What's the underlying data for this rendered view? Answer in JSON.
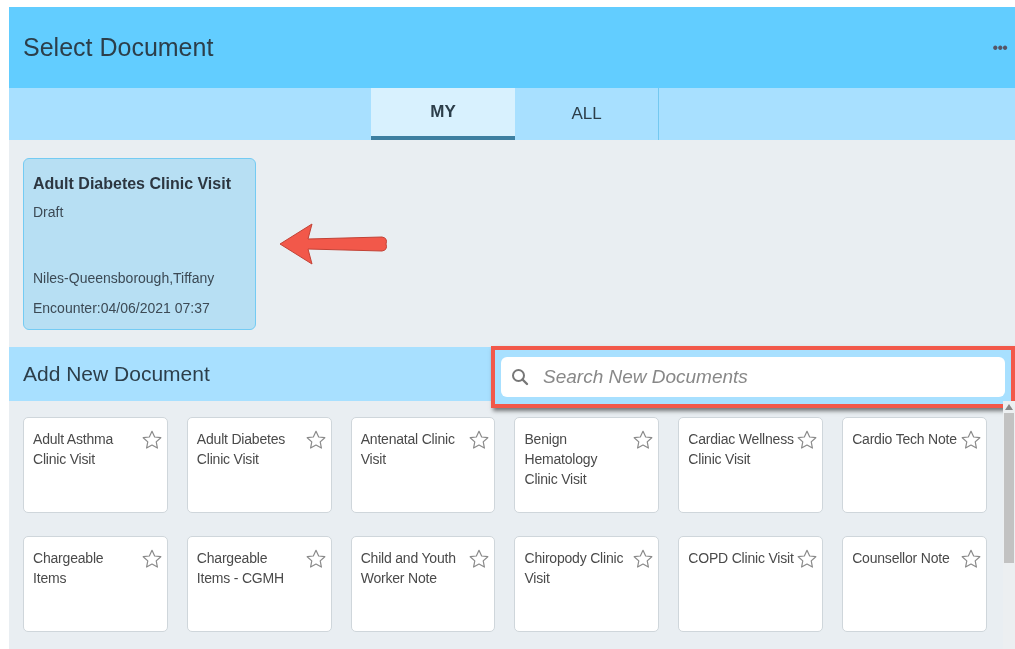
{
  "header": {
    "title": "Select Document",
    "menu": "•••"
  },
  "tabs": [
    {
      "label": "MY",
      "selected": true
    },
    {
      "label": "ALL",
      "selected": false
    }
  ],
  "draft": {
    "title": "Adult Diabetes Clinic Visit",
    "status": "Draft",
    "author": "Niles-Queensborough,Tiffany",
    "encounter": "Encounter:04/06/2021 07:37"
  },
  "add_section": {
    "title": "Add New Document",
    "search": {
      "placeholder": "Search New Documents"
    }
  },
  "documents": [
    {
      "name": "Adult Asthma Clinic Visit",
      "starred": false
    },
    {
      "name": "Adult Diabetes Clinic Visit",
      "starred": false
    },
    {
      "name": "Antenatal Clinic Visit",
      "starred": false
    },
    {
      "name": "Benign Hematology Clinic Visit",
      "starred": false
    },
    {
      "name": "Cardiac Wellness Clinic Visit",
      "starred": false
    },
    {
      "name": "Cardio Tech Note",
      "starred": false
    },
    {
      "name": "Chargeable Items",
      "starred": false
    },
    {
      "name": "Chargeable Items - CGMH",
      "starred": false
    },
    {
      "name": "Child and Youth Worker Note",
      "starred": false
    },
    {
      "name": "Chiropody Clinic Visit",
      "starred": false
    },
    {
      "name": "COPD Clinic Visit",
      "starred": false
    },
    {
      "name": "Counsellor Note",
      "starred": false
    }
  ]
}
